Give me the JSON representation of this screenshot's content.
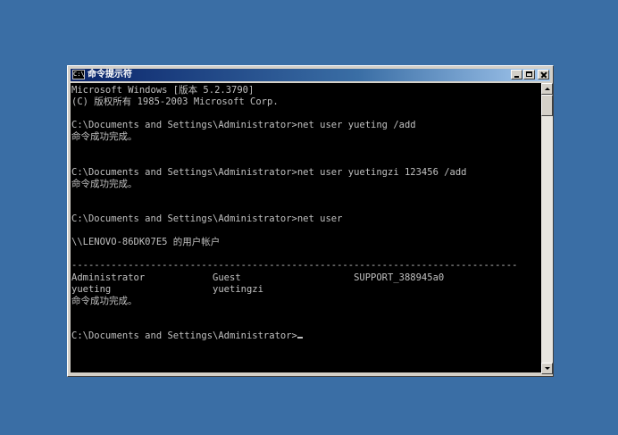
{
  "window": {
    "title": "命令提示符",
    "icon_label": "C:\\"
  },
  "icons": {
    "title_icon": "cmd-icon",
    "minimize": "minimize-icon",
    "maximize": "maximize-icon",
    "close": "close-icon",
    "scroll_up": "arrow-up-icon",
    "scroll_down": "arrow-down-icon"
  },
  "console": {
    "lines": [
      "Microsoft Windows [版本 5.2.3790]",
      "(C) 版权所有 1985-2003 Microsoft Corp.",
      "",
      "C:\\Documents and Settings\\Administrator>net user yueting /add",
      "命令成功完成。",
      "",
      "",
      "C:\\Documents and Settings\\Administrator>net user yuetingzi 123456 /add",
      "命令成功完成。",
      "",
      "",
      "C:\\Documents and Settings\\Administrator>net user",
      "",
      "\\\\LENOVO-86DK07E5 的用户帐户",
      "",
      "-------------------------------------------------------------------------------",
      "Administrator            Guest                    SUPPORT_388945a0",
      "yueting                  yuetingzi",
      "命令成功完成。",
      "",
      "",
      "C:\\Documents and Settings\\Administrator>"
    ]
  },
  "colors": {
    "desktop": "#3a6ea5",
    "console_bg": "#000000",
    "console_fg": "#c0c0c0",
    "title_active": "#0a246a"
  }
}
